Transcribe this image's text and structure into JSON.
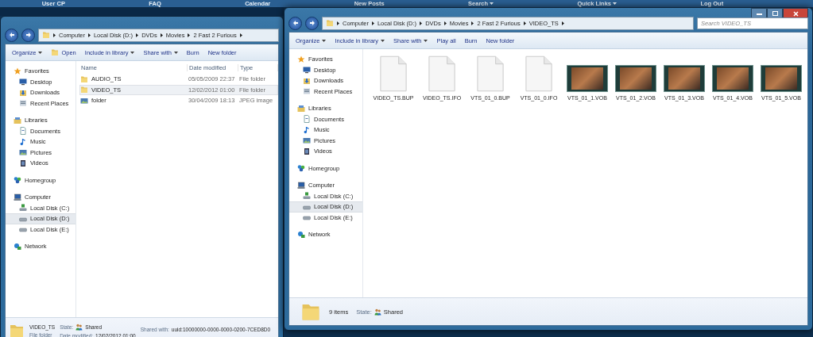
{
  "background_nav": [
    {
      "label": "User CP",
      "dropdown": false
    },
    {
      "label": "FAQ",
      "dropdown": false
    },
    {
      "label": "Calendar",
      "dropdown": false
    },
    {
      "label": "New Posts",
      "dropdown": false
    },
    {
      "label": "Search",
      "dropdown": true
    },
    {
      "label": "Quick Links",
      "dropdown": true
    },
    {
      "label": "Log Out",
      "dropdown": false
    }
  ],
  "back_window": {
    "address": [
      "Computer",
      "Local Disk (D:)",
      "DVDs",
      "Movies",
      "2 Fast 2 Furious"
    ],
    "toolbar": [
      {
        "label": "Organize",
        "dropdown": true,
        "kind": "text"
      },
      {
        "label": "Open",
        "dropdown": false,
        "kind": "open"
      },
      {
        "label": "Include in library",
        "dropdown": true,
        "kind": "text"
      },
      {
        "label": "Share with",
        "dropdown": true,
        "kind": "text"
      },
      {
        "label": "Burn",
        "dropdown": false,
        "kind": "text"
      },
      {
        "label": "New folder",
        "dropdown": false,
        "kind": "text"
      }
    ],
    "nav": [
      {
        "label": "Favorites",
        "kind": "star",
        "children": [
          {
            "label": "Desktop",
            "kind": "desktop",
            "selected": false
          },
          {
            "label": "Downloads",
            "kind": "downloads",
            "selected": false
          },
          {
            "label": "Recent Places",
            "kind": "recent",
            "selected": false
          }
        ]
      },
      {
        "label": "Libraries",
        "kind": "library",
        "children": [
          {
            "label": "Documents",
            "kind": "document",
            "selected": false
          },
          {
            "label": "Music",
            "kind": "music",
            "selected": false
          },
          {
            "label": "Pictures",
            "kind": "pictures",
            "selected": false
          },
          {
            "label": "Videos",
            "kind": "videos",
            "selected": false
          }
        ]
      },
      {
        "label": "Homegroup",
        "kind": "homegroup"
      },
      {
        "label": "Computer",
        "kind": "computer",
        "children": [
          {
            "label": "Local Disk (C:)",
            "kind": "system-drive",
            "selected": false
          },
          {
            "label": "Local Disk (D:)",
            "kind": "drive",
            "selected": true
          },
          {
            "label": "Local Disk (E:)",
            "kind": "drive",
            "selected": false
          }
        ]
      },
      {
        "label": "Network",
        "kind": "network"
      }
    ],
    "columns": [
      "Name",
      "Date modified",
      "Type"
    ],
    "rows": [
      {
        "name": "AUDIO_TS",
        "date": "05/05/2009 22:37",
        "type": "File folder",
        "kind": "folder",
        "selected": false
      },
      {
        "name": "VIDEO_TS",
        "date": "12/02/2012 01:00",
        "type": "File folder",
        "kind": "folder",
        "selected": true
      },
      {
        "name": "folder",
        "date": "30/04/2009 18:13",
        "type": "JPEG image",
        "kind": "image",
        "selected": false
      }
    ],
    "details": {
      "name": "VIDEO_TS",
      "type": "File folder",
      "state_label": "State:",
      "state": "Shared",
      "date_label": "Date modified:",
      "date": "12/02/2012 01:00",
      "shared_label": "Shared with:",
      "shared": "uuid:10000000-0000-0000-0200-7CED8D0"
    }
  },
  "front_window": {
    "address": [
      "Computer",
      "Local Disk (D:)",
      "DVDs",
      "Movies",
      "2 Fast 2 Furious",
      "VIDEO_TS"
    ],
    "search": {
      "placeholder": "Search VIDEO_TS"
    },
    "toolbar": [
      {
        "label": "Organize",
        "dropdown": true,
        "kind": "text"
      },
      {
        "label": "Include in library",
        "dropdown": true,
        "kind": "text"
      },
      {
        "label": "Share with",
        "dropdown": true,
        "kind": "text"
      },
      {
        "label": "Play all",
        "dropdown": false,
        "kind": "text"
      },
      {
        "label": "Burn",
        "dropdown": false,
        "kind": "text"
      },
      {
        "label": "New folder",
        "dropdown": false,
        "kind": "text"
      }
    ],
    "nav": [
      {
        "label": "Favorites",
        "kind": "star",
        "children": [
          {
            "label": "Desktop",
            "kind": "desktop",
            "selected": false
          },
          {
            "label": "Downloads",
            "kind": "downloads",
            "selected": false
          },
          {
            "label": "Recent Places",
            "kind": "recent",
            "selected": false
          }
        ]
      },
      {
        "label": "Libraries",
        "kind": "library",
        "children": [
          {
            "label": "Documents",
            "kind": "document",
            "selected": false
          },
          {
            "label": "Music",
            "kind": "music",
            "selected": false
          },
          {
            "label": "Pictures",
            "kind": "pictures",
            "selected": false
          },
          {
            "label": "Videos",
            "kind": "videos",
            "selected": false
          }
        ]
      },
      {
        "label": "Homegroup",
        "kind": "homegroup"
      },
      {
        "label": "Computer",
        "kind": "computer",
        "children": [
          {
            "label": "Local Disk (C:)",
            "kind": "system-drive",
            "selected": false
          },
          {
            "label": "Local Disk (D:)",
            "kind": "drive",
            "selected": true
          },
          {
            "label": "Local Disk (E:)",
            "kind": "drive",
            "selected": false
          }
        ]
      },
      {
        "label": "Network",
        "kind": "network"
      }
    ],
    "files": [
      {
        "name": "VIDEO_TS.BUP",
        "kind": "blank"
      },
      {
        "name": "VIDEO_TS.IFO",
        "kind": "blank"
      },
      {
        "name": "VTS_01_0.BUP",
        "kind": "blank"
      },
      {
        "name": "VTS_01_0.IFO",
        "kind": "blank"
      },
      {
        "name": "VTS_01_1.VOB",
        "kind": "video"
      },
      {
        "name": "VTS_01_2.VOB",
        "kind": "video"
      },
      {
        "name": "VTS_01_3.VOB",
        "kind": "video"
      },
      {
        "name": "VTS_01_4.VOB",
        "kind": "video"
      },
      {
        "name": "VTS_01_5.VOB",
        "kind": "video"
      }
    ],
    "status": {
      "count": "9 items",
      "state_label": "State:",
      "state": "Shared"
    }
  }
}
